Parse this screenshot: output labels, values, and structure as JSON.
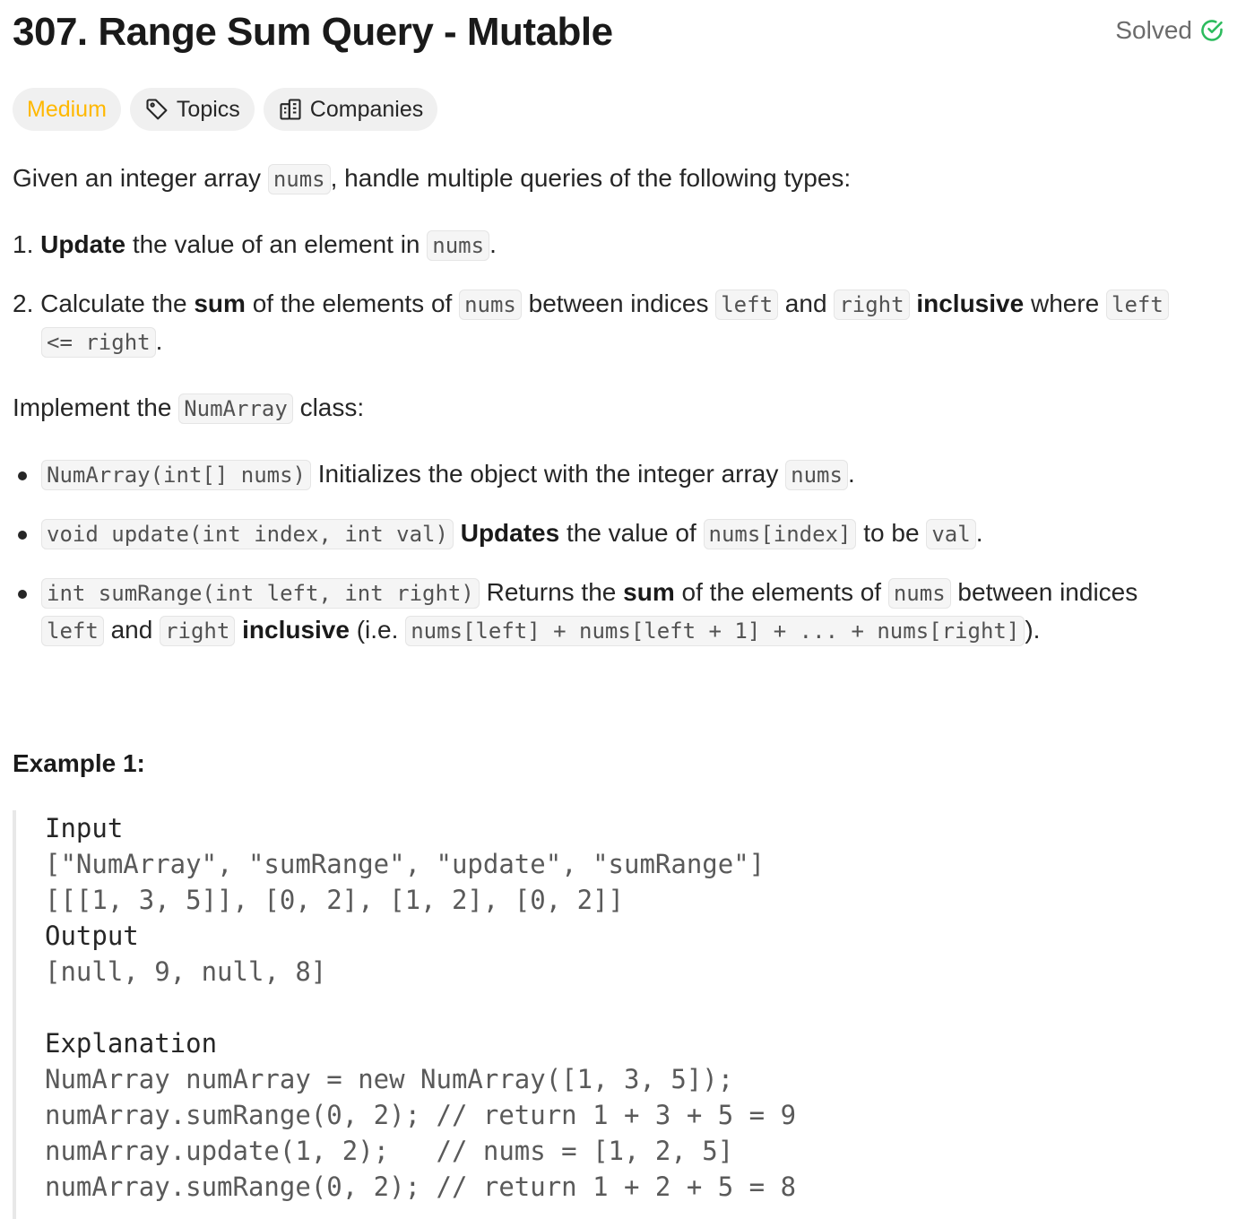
{
  "problem": {
    "title": "307. Range Sum Query - Mutable",
    "status": "Solved",
    "difficulty": "Medium",
    "topics_label": "Topics",
    "companies_label": "Companies"
  },
  "description": {
    "intro": [
      "Given an integer array ",
      "nums",
      ", handle multiple queries of the following types:"
    ],
    "item1": [
      "1. ",
      "Update",
      " the value of an element in ",
      "nums",
      "."
    ],
    "item2_line1": [
      "2. ",
      "Calculate the ",
      "sum",
      " of the elements of ",
      "nums",
      " between indices ",
      "left",
      " and ",
      "right",
      " ",
      "inclusive",
      " where ",
      "left"
    ],
    "item2_line2": [
      "<= right",
      "."
    ],
    "implement": [
      "Implement the ",
      "NumArray",
      " class:"
    ],
    "bullet1": [
      "NumArray(int[] nums)",
      " Initializes the object with the integer array ",
      "nums",
      "."
    ],
    "bullet2": [
      "void update(int index, int val)",
      " ",
      "Updates",
      " the value of ",
      "nums[index]",
      " to be ",
      "val",
      "."
    ],
    "bullet3_line1": [
      "int sumRange(int left, int right)",
      " Returns the ",
      "sum",
      " of the elements of ",
      "nums",
      " between indices"
    ],
    "bullet3_line2": [
      "left",
      " and ",
      "right",
      " ",
      "inclusive",
      " (i.e. ",
      "nums[left] + nums[left + 1] + ... + nums[right]",
      ")."
    ]
  },
  "example": {
    "title": "Example 1:",
    "input_label": "Input",
    "input_line1": "[\"NumArray\", \"sumRange\", \"update\", \"sumRange\"]",
    "input_line2": "[[[1, 3, 5]], [0, 2], [1, 2], [0, 2]]",
    "output_label": "Output",
    "output_line": "[null, 9, null, 8]",
    "explanation_label": "Explanation",
    "explanation_lines": [
      "NumArray numArray = new NumArray([1, 3, 5]);",
      "numArray.sumRange(0, 2); // return 1 + 3 + 5 = 9",
      "numArray.update(1, 2);   // nums = [1, 2, 5]",
      "numArray.sumRange(0, 2); // return 1 + 2 + 5 = 8"
    ]
  },
  "colors": {
    "medium": "#ffb800",
    "solved_check": "#2cbb5d"
  }
}
